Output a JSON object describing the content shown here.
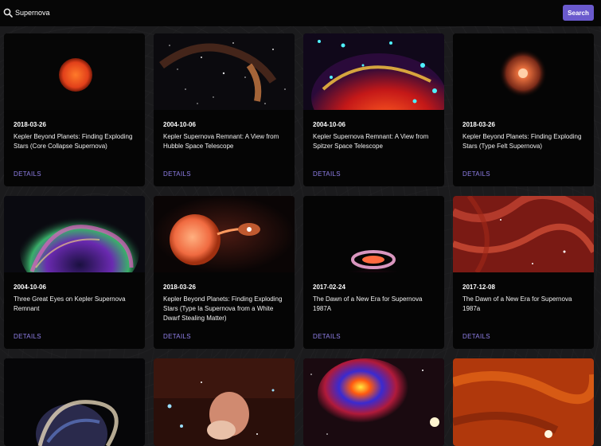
{
  "search": {
    "value": "Supernova",
    "button_label": "Search"
  },
  "cards": [
    {
      "date": "2018-03-26",
      "title": "Kepler Beyond Planets: Finding Exploding Stars (Core Collapse Supernova)",
      "details": "DETAILS"
    },
    {
      "date": "2004-10-06",
      "title": "Kepler Supernova Remnant: A View from Hubble Space Telescope",
      "details": "DETAILS"
    },
    {
      "date": "2004-10-06",
      "title": "Kepler Supernova Remnant: A View from Spitzer Space Telescope",
      "details": "DETAILS"
    },
    {
      "date": "2018-03-26",
      "title": "Kepler Beyond Planets: Finding Exploding Stars (Type Felt Supernova)",
      "details": "DETAILS"
    },
    {
      "date": "2004-10-06",
      "title": "Three Great Eyes on Kepler Supernova Remnant",
      "details": "DETAILS"
    },
    {
      "date": "2018-03-26",
      "title": "Kepler Beyond Planets: Finding Exploding Stars (Type Ia Supernova from a White Dwarf Stealing Matter)",
      "details": "DETAILS"
    },
    {
      "date": "2017-02-24",
      "title": "The Dawn of a New Era for Supernova 1987A",
      "details": "DETAILS"
    },
    {
      "date": "2017-12-08",
      "title": "The Dawn of a New Era for Supernova 1987a",
      "details": "DETAILS"
    }
  ],
  "icons": {
    "search": "search-icon"
  },
  "colors": {
    "accent": "#6a5acd",
    "link": "#8f7fe8",
    "card": "#050505"
  }
}
